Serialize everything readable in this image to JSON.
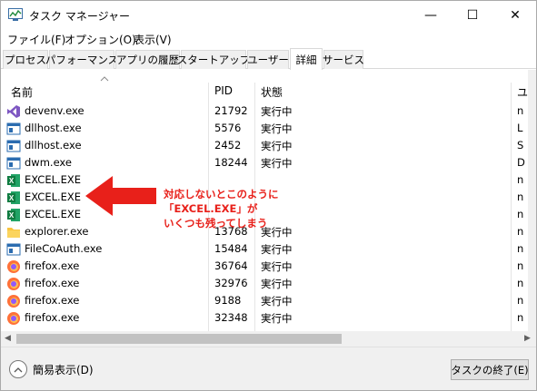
{
  "window": {
    "title": "タスク マネージャー",
    "icon": "task-manager-icon",
    "minimize": "—",
    "maximize": "☐",
    "close": "✕"
  },
  "menu": [
    "ファイル(F)",
    "オプション(O)",
    "表示(V)"
  ],
  "tabs": [
    "プロセス",
    "パフォーマンス",
    "アプリの履歴",
    "スタートアップ",
    "ユーザー",
    "詳細",
    "サービス"
  ],
  "active_tab": "詳細",
  "columns": {
    "name": "名前",
    "pid": "PID",
    "status": "状態",
    "extra": "ユ"
  },
  "rows": [
    {
      "icon": "visual-studio-icon",
      "name": "devenv.exe",
      "pid": "21792",
      "status": "実行中",
      "extra": "n"
    },
    {
      "icon": "window-app-icon",
      "name": "dllhost.exe",
      "pid": "5576",
      "status": "実行中",
      "extra": "L"
    },
    {
      "icon": "window-app-icon",
      "name": "dllhost.exe",
      "pid": "2452",
      "status": "実行中",
      "extra": "S"
    },
    {
      "icon": "window-app-icon",
      "name": "dwm.exe",
      "pid": "18244",
      "status": "実行中",
      "extra": "D"
    },
    {
      "icon": "excel-icon",
      "name": "EXCEL.EXE",
      "pid": "",
      "status": "",
      "extra": "n"
    },
    {
      "icon": "excel-icon",
      "name": "EXCEL.EXE",
      "pid": "",
      "status": "",
      "extra": "n"
    },
    {
      "icon": "excel-icon",
      "name": "EXCEL.EXE",
      "pid": "",
      "status": "",
      "extra": "n"
    },
    {
      "icon": "folder-icon",
      "name": "explorer.exe",
      "pid": "13768",
      "status": "実行中",
      "extra": "n"
    },
    {
      "icon": "window-app-icon",
      "name": "FileCoAuth.exe",
      "pid": "15484",
      "status": "実行中",
      "extra": "n"
    },
    {
      "icon": "firefox-icon",
      "name": "firefox.exe",
      "pid": "36764",
      "status": "実行中",
      "extra": "n"
    },
    {
      "icon": "firefox-icon",
      "name": "firefox.exe",
      "pid": "32976",
      "status": "実行中",
      "extra": "n"
    },
    {
      "icon": "firefox-icon",
      "name": "firefox.exe",
      "pid": "9188",
      "status": "実行中",
      "extra": "n"
    },
    {
      "icon": "firefox-icon",
      "name": "firefox.exe",
      "pid": "32348",
      "status": "実行中",
      "extra": "n"
    }
  ],
  "footer": {
    "fewer_details": "簡易表示(D)",
    "end_task": "タスクの終了(E)"
  },
  "annotation": {
    "line1": "対応しないとこのように",
    "line2": "「EXCEL.EXE」が",
    "line3": "いくつも残ってしまう",
    "color": "#e8201a"
  }
}
